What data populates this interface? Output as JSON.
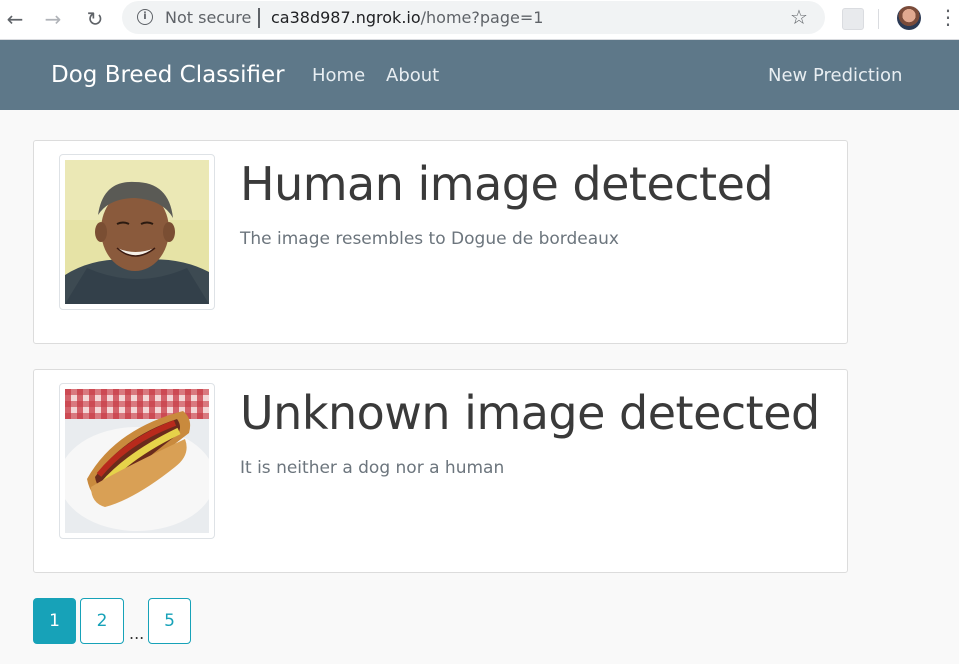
{
  "browser": {
    "security_label": "Not secure",
    "url_host": "ca38d987.ngrok.io",
    "url_path": "/home?page=1"
  },
  "navbar": {
    "brand": "Dog Breed Classifier",
    "links": [
      "Home",
      "About"
    ],
    "new_prediction": "New Prediction"
  },
  "results": [
    {
      "title": "Human image detected",
      "description": "The image resembles to Dogue de bordeaux",
      "image": "human-face-photo"
    },
    {
      "title": "Unknown image detected",
      "description": "It is neither a dog nor a human",
      "image": "hotdog-photo"
    }
  ],
  "pagination": {
    "pages": [
      "1",
      "2",
      "5"
    ],
    "ellipsis": "...",
    "active": "1"
  },
  "colors": {
    "navbar": "#5e7889",
    "accent": "#17a2b8"
  }
}
